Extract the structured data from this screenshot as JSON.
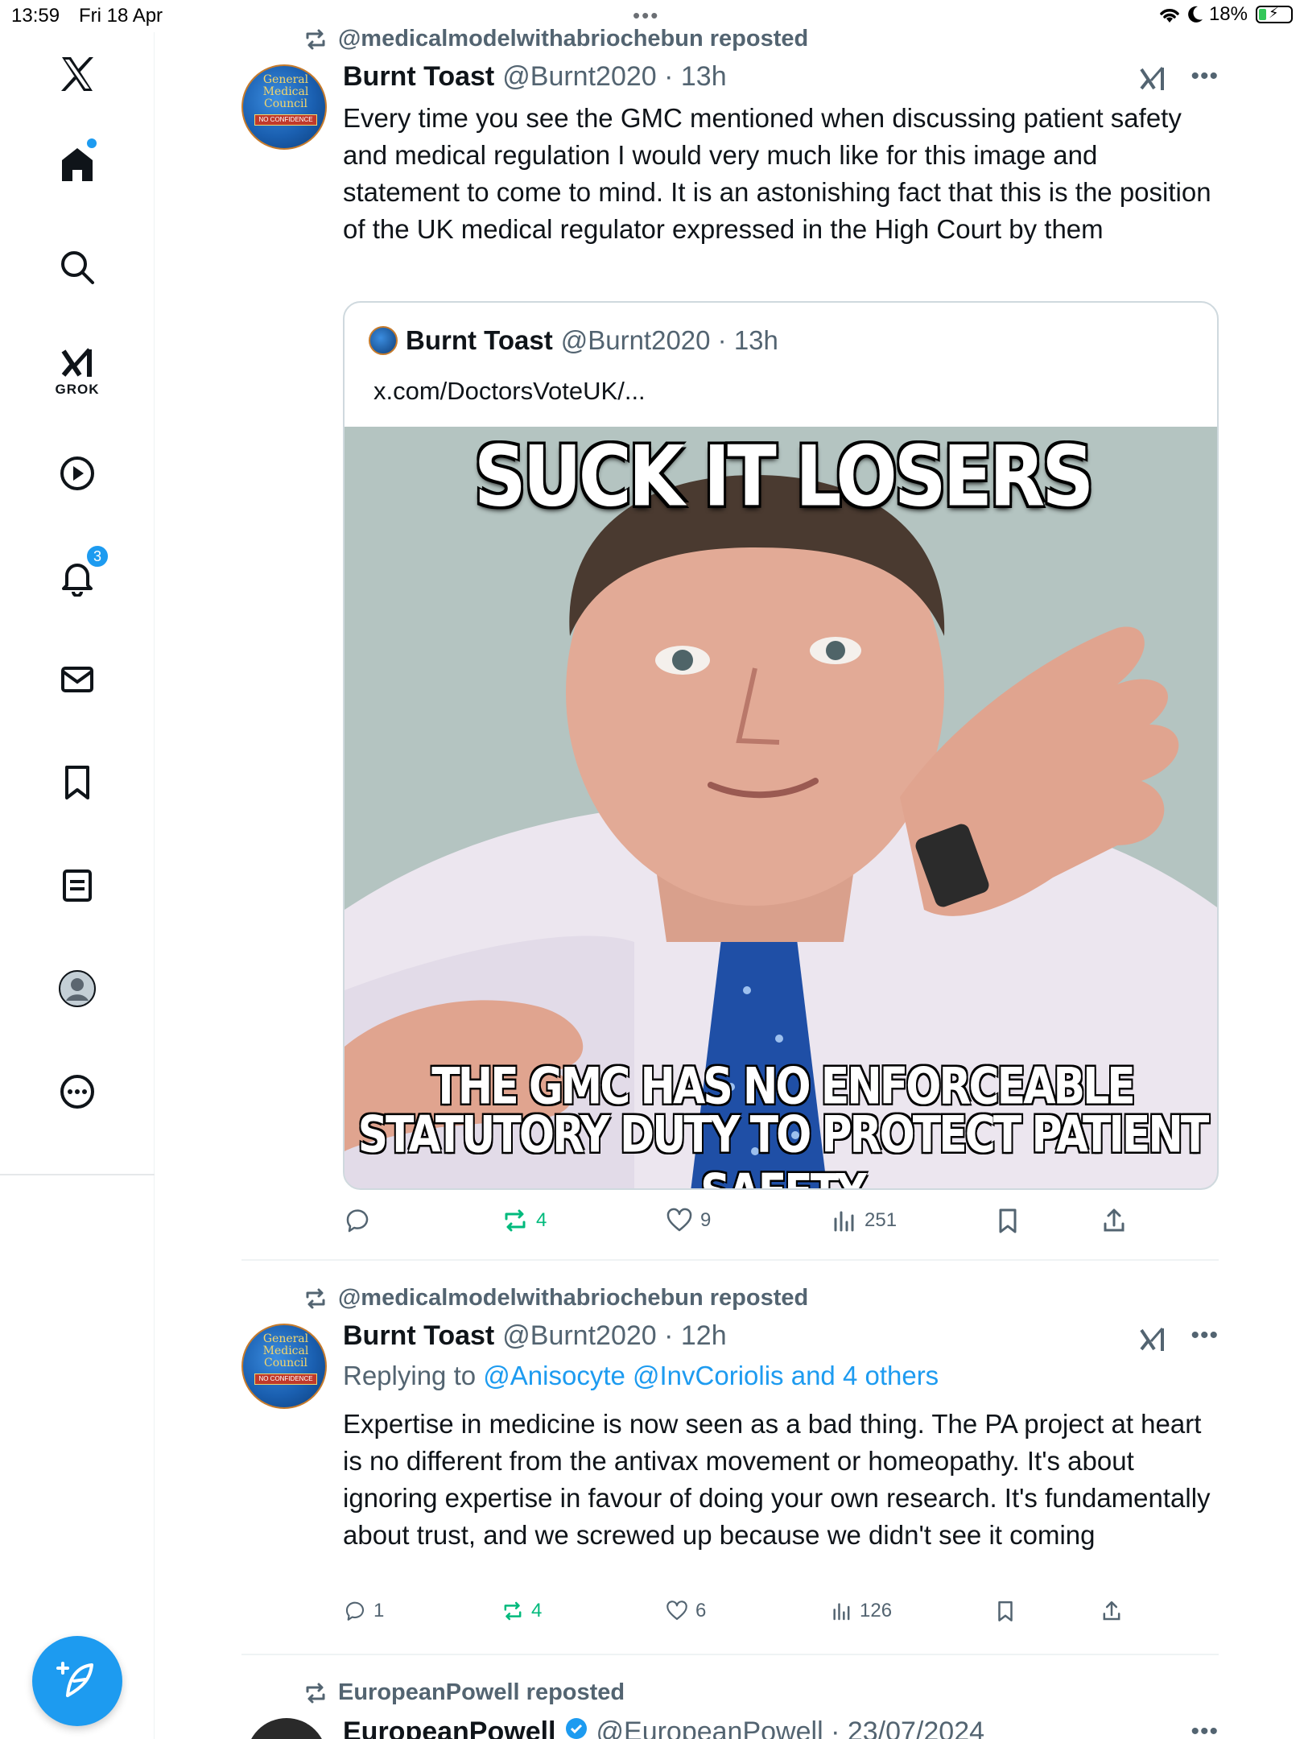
{
  "status_bar": {
    "time": "13:59",
    "date": "Fri 18 Apr",
    "battery": "18%"
  },
  "sidebar": {
    "grok_label": "GROK",
    "notifications_count": "3"
  },
  "posts": [
    {
      "repost_by": "@medicalmodelwithabriochebun reposted",
      "author": "Burnt Toast",
      "handle_time": "@Burnt2020 · 13h",
      "text": "Every time you see the GMC mentioned when discussing patient safety and medical regulation I would very much like for this image and statement to come to mind. It is an astonishing fact that this is the position of the UK medical regulator expressed in the High Court by them",
      "quote": {
        "author": "Burnt Toast",
        "handle_time": "@Burnt2020 · 13h",
        "link": "x.com/DoctorsVoteUK/...",
        "meme_top": "SUCK IT LOSERS",
        "meme_bottom_1": "THE GMC HAS NO ENFORCEABLE",
        "meme_bottom_2": "STATUTORY DUTY TO PROTECT PATIENT SAFETY"
      },
      "actions": {
        "replies": "",
        "reposts": "4",
        "likes": "9",
        "views": "251"
      }
    },
    {
      "repost_by": "@medicalmodelwithabriochebun reposted",
      "author": "Burnt Toast",
      "handle_time": "@Burnt2020 · 12h",
      "reply_prefix": "Replying to ",
      "reply_targets": "@Anisocyte @InvCoriolis and 4 others",
      "text": "Expertise in medicine is now seen as a bad thing. The PA project at heart is no different from the antivax movement or homeopathy. It's about ignoring expertise in favour of doing your own research. It's fundamentally about trust, and we screwed up because we didn't see it coming",
      "actions": {
        "replies": "1",
        "reposts": "4",
        "likes": "6",
        "views": "126"
      }
    },
    {
      "repost_by": "EuropeanPowell reposted",
      "author": "EuropeanPowell",
      "handle_time": "@EuropeanPowell · 23/07/2024"
    }
  ],
  "avatar_text": "General Medical Council",
  "avatar_band": "NO CONFIDENCE",
  "colors": {
    "accent": "#1d9bf0",
    "repost_green": "#00ba7c",
    "muted": "#536471"
  }
}
